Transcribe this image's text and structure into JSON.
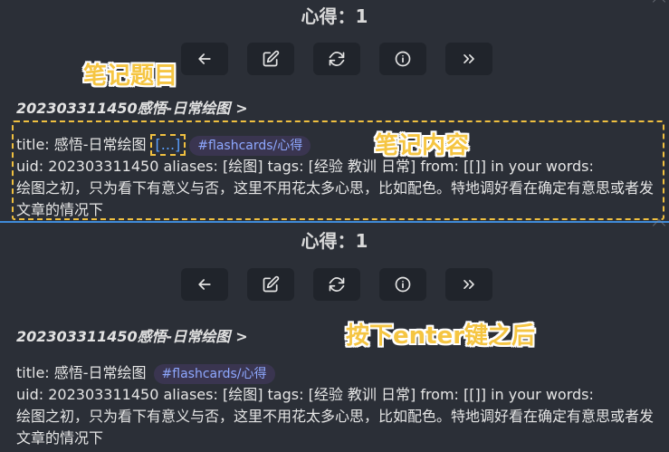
{
  "panel_top": {
    "title": "心得：1",
    "breadcrumb": "202303311450感悟-日常绘图",
    "breadcrumb_chevron": ">",
    "line1_prefix": "title: 感悟-日常绘图",
    "ellipsis": "[...]",
    "tag": "#flashcards/心得",
    "line2": "uid: 202303311450 aliases: [绘图] tags: [经验 教训 日常] from: [[]] in your words:",
    "line3": "绘图之初，只为看下有意义与否，这里不用花太多心思，比如配色。特地调好看在确定有意思或者发文章的情况下",
    "annotation_title": "笔记题目",
    "annotation_content": "笔记内容"
  },
  "panel_bottom": {
    "title": "心得：1",
    "breadcrumb": "202303311450感悟-日常绘图",
    "breadcrumb_chevron": ">",
    "line1_prefix": "title: 感悟-日常绘图",
    "tag": "#flashcards/心得",
    "line2": "uid: 202303311450 aliases: [绘图] tags: [经验 教训 日常] from: [[]] in your words:",
    "line3": "绘图之初，只为看下有意义与否，这里不用花太多心思，比如配色。特地调好看在确定有意思或者发文章的情况下",
    "annotation_enter": "按下enter键之后"
  },
  "toolbar_icons": [
    "arrow-left-icon",
    "edit-icon",
    "refresh-icon",
    "info-icon",
    "chevrons-right-icon"
  ],
  "colors": {
    "accent_annotation": "#f5c542",
    "tag_text": "#8ea8ff",
    "divider": "#3f8ad8"
  }
}
